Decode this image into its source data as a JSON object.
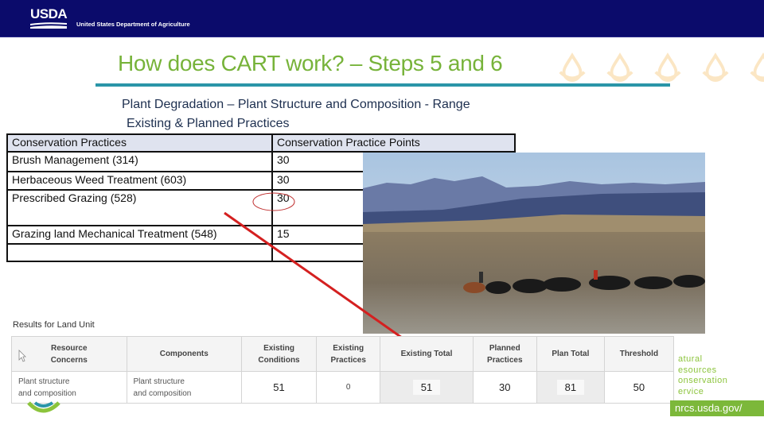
{
  "header": {
    "logo_text": "USDA",
    "department": "United States Department of Agriculture"
  },
  "slide": {
    "title": "How does CART work? – Steps 5 and 6",
    "subtitle_line1": "Plant Degradation – Plant Structure and Composition - Range",
    "subtitle_line2": "Existing & Planned Practices"
  },
  "practices_table": {
    "headers": [
      "Conservation Practices",
      "Conservation Practice Points"
    ],
    "rows": [
      {
        "practice": "Brush Management (314)",
        "points": "30"
      },
      {
        "practice": "Herbaceous Weed Treatment (603)",
        "points": "30"
      },
      {
        "practice": "Prescribed Grazing (528)",
        "points": "30",
        "highlighted": true
      },
      {
        "practice": "Grazing land Mechanical Treatment (548)",
        "points": "15"
      },
      {
        "practice": "",
        "points": ""
      }
    ]
  },
  "photo": {
    "description": "Cattle being herded by riders on horseback across sagebrush rangeland with mountains in background"
  },
  "results": {
    "label": "Results for Land Unit",
    "headers": [
      "Resource Concerns",
      "Components",
      "Existing Conditions",
      "Existing Practices",
      "Existing Total",
      "Planned Practices",
      "Plan Total",
      "Threshold"
    ],
    "header_lines": [
      [
        "Resource",
        "Concerns"
      ],
      [
        "Components"
      ],
      [
        "Existing",
        "Conditions"
      ],
      [
        "Existing",
        "Practices"
      ],
      [
        "Existing Total"
      ],
      [
        "Planned",
        "Practices"
      ],
      [
        "Plan Total"
      ],
      [
        "Threshold"
      ]
    ],
    "row": {
      "resource_concern_line1": "Plant structure",
      "resource_concern_line2": "and composition",
      "component_line1": "Plant structure",
      "component_line2": "and composition",
      "existing_conditions": "51",
      "existing_practices": "0",
      "existing_total": "51",
      "planned_practices": "30",
      "plan_total": "81",
      "threshold": "50"
    }
  },
  "footer": {
    "agency_lines": [
      "atural",
      "esources",
      "onservation",
      "ervice"
    ],
    "url": "nrcs.usda.gov/"
  },
  "colors": {
    "header_bg": "#0b0b6b",
    "title_green": "#77b33a",
    "rule_teal": "#2a95a8",
    "annotation_red": "#d42020",
    "nrcs_green": "#7cb83a"
  }
}
